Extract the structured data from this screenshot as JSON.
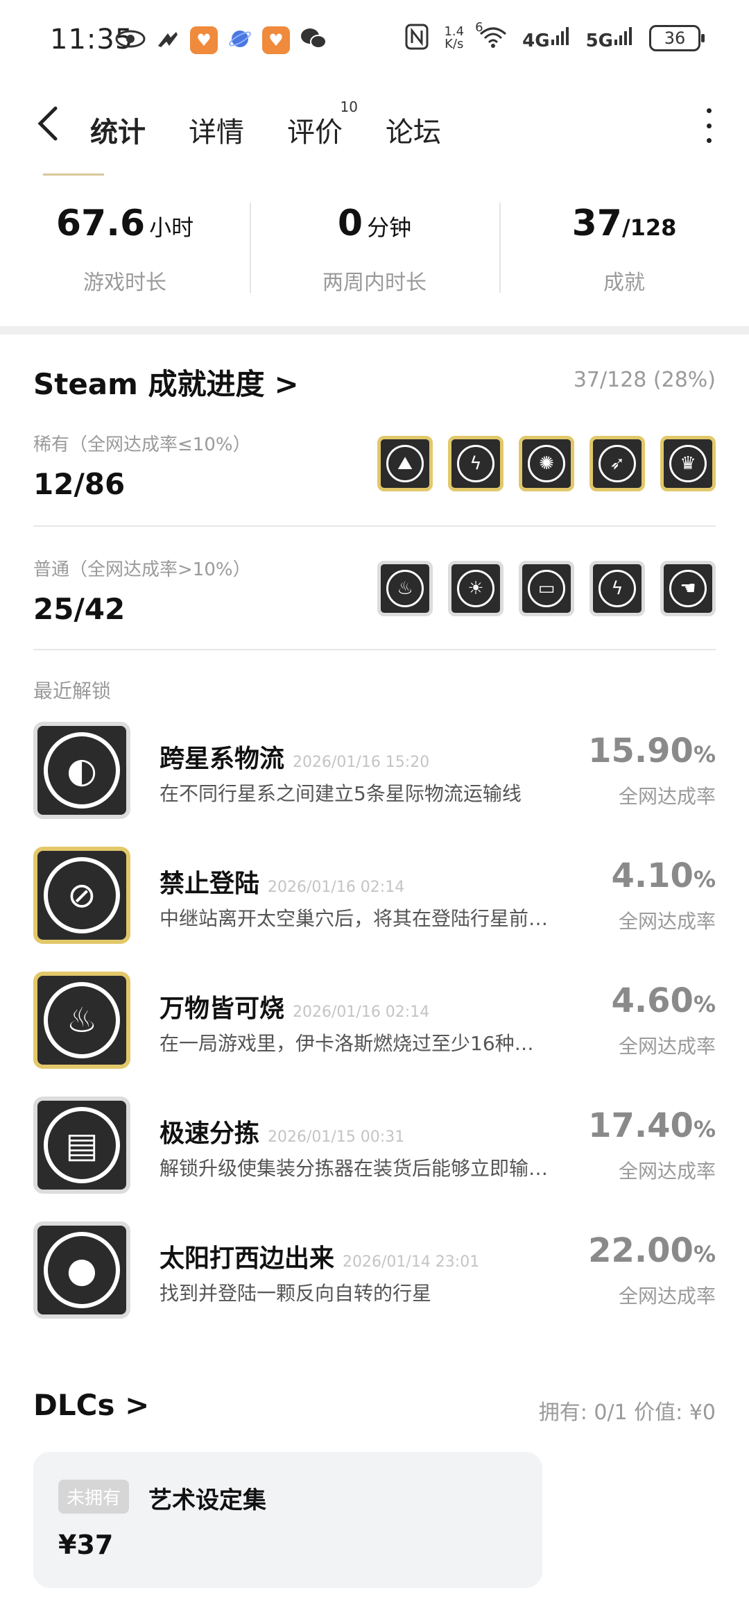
{
  "status_bar": {
    "time": "11:35",
    "net_speed_top": "1.4",
    "net_speed_bottom": "K/s",
    "wifi_badge": "6",
    "sig1": "4G",
    "sig2": "5G",
    "battery": "36",
    "icons": [
      "eye-icon",
      "infinity-icon",
      "heart-app-icon",
      "planet-app-icon",
      "heart-app-icon",
      "wechat-icon",
      "nfc-icon",
      "wifi-icon",
      "signal-icon",
      "signal-icon"
    ]
  },
  "nav": {
    "back": "<",
    "tabs": [
      {
        "label": "统计",
        "active": true
      },
      {
        "label": "详情"
      },
      {
        "label": "评价",
        "badge": "10"
      },
      {
        "label": "论坛"
      }
    ]
  },
  "stats": [
    {
      "value": "67.6",
      "unit": "小时",
      "label": "游戏时长"
    },
    {
      "value": "0",
      "unit": "分钟",
      "label": "两周内时长"
    },
    {
      "value": "37",
      "unit": "/128",
      "label": "成就"
    }
  ],
  "achievements": {
    "title": "Steam 成就进度",
    "chevron": ">",
    "progress": "37/128 (28%)",
    "rare": {
      "label": "稀有（全网达成率≤10%）",
      "count": "12/86"
    },
    "common": {
      "label": "普通（全网达成率>10%）",
      "count": "25/42"
    },
    "recent_label": "最近解锁",
    "recent": [
      {
        "name": "跨星系物流",
        "date": "2026/01/16 15:20",
        "desc": "在不同行星系之间建立5条星际物流运输线",
        "rate": "15.90",
        "rate_unit": "%",
        "rate_label": "全网达成率",
        "tier": "common"
      },
      {
        "name": "禁止登陆",
        "date": "2026/01/16 02:14",
        "desc": "中继站离开太空巢穴后，将其在登陆行星前…",
        "rate": "4.10",
        "rate_unit": "%",
        "rate_label": "全网达成率",
        "tier": "rare"
      },
      {
        "name": "万物皆可烧",
        "date": "2026/01/16 02:14",
        "desc": "在一局游戏里，伊卡洛斯燃烧过至少16种不…",
        "rate": "4.60",
        "rate_unit": "%",
        "rate_label": "全网达成率",
        "tier": "rare"
      },
      {
        "name": "极速分拣",
        "date": "2026/01/15 00:31",
        "desc": "解锁升级使集装分拣器在装货后能够立即输…",
        "rate": "17.40",
        "rate_unit": "%",
        "rate_label": "全网达成率",
        "tier": "common"
      },
      {
        "name": "太阳打西边出来",
        "date": "2026/01/14 23:01",
        "desc": "找到并登陆一颗反向自转的行星",
        "rate": "22.00",
        "rate_unit": "%",
        "rate_label": "全网达成率",
        "tier": "common"
      }
    ]
  },
  "dlc": {
    "title": "DLCs",
    "chevron": ">",
    "meta": "拥有: 0/1 价值: ¥0",
    "card": {
      "tag": "未拥有",
      "name": "艺术设定集",
      "price": "¥37"
    }
  },
  "colors": {
    "accent": "#5fd0c0",
    "rare_border": "#e2c86a",
    "common_border": "#dcdcdc",
    "badge_bg": "#2b2b2b"
  }
}
